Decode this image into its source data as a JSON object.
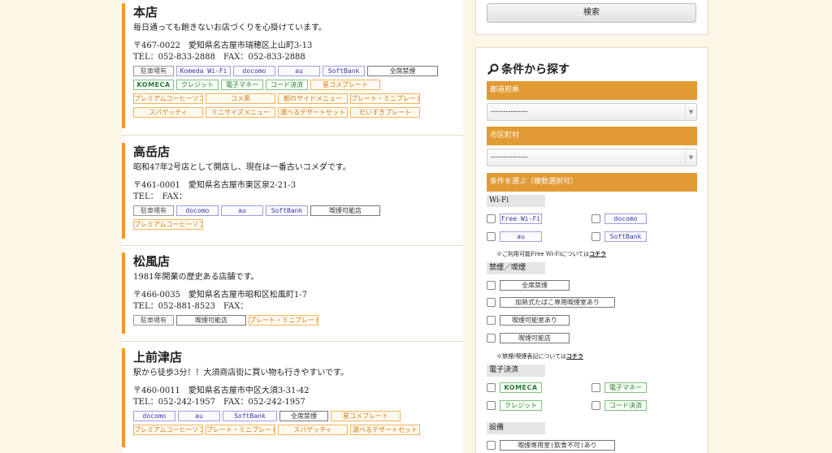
{
  "stores": [
    {
      "name": "本店",
      "description": "毎日通っても飽きないお店づくりを心掛けています。",
      "address": "〒467-0022　愛知県名古屋市瑞穂区上山町3-13",
      "tel": "TEL：052-833-2888　FAX：052-833-2888",
      "tag_rows": [
        [
          {
            "label": "駐車場有",
            "style": "gray",
            "w": 50
          },
          {
            "label": "Komeda Wi-Fi",
            "style": "blue",
            "w": 67
          },
          {
            "label": "docomo",
            "style": "blue",
            "w": 52
          },
          {
            "label": "au",
            "style": "blue",
            "w": 52
          },
          {
            "label": "SoftBank",
            "style": "blue",
            "w": 52
          },
          {
            "label": "全席禁煙",
            "style": "dark",
            "w": 87
          }
        ],
        [
          {
            "label": "KOMECA",
            "style": "green",
            "w": 50,
            "logo": true
          },
          {
            "label": "クレジット",
            "style": "green",
            "w": 52
          },
          {
            "label": "電子マネー",
            "style": "green",
            "w": 52
          },
          {
            "label": "コード決済",
            "style": "green",
            "w": 52
          },
          {
            "label": "星コメプレート",
            "style": "orange",
            "w": 86
          }
        ],
        [
          {
            "label": "プレミアムコーヒーソフィア",
            "style": "orange",
            "w": 86
          },
          {
            "label": "コメ黒",
            "style": "orange",
            "w": 86
          },
          {
            "label": "朝のサイドメニュー",
            "style": "orange",
            "w": 86
          },
          {
            "label": "プレート・ミニプレート",
            "style": "orange",
            "w": 86
          }
        ],
        [
          {
            "label": "スパゲッティ",
            "style": "orange",
            "w": 86
          },
          {
            "label": "ミニサイズメニュー",
            "style": "orange",
            "w": 86
          },
          {
            "label": "選べるデザートセット",
            "style": "orange",
            "w": 86
          },
          {
            "label": "だいすきプレート",
            "style": "orange",
            "w": 86
          }
        ]
      ]
    },
    {
      "name": "高岳店",
      "description": "昭和47年2号店として開店し、現在は一番古いコメダです。",
      "address": "〒461-0001　愛知県名古屋市東区泉2-21-3",
      "tel": "TEL：　FAX：",
      "tag_rows": [
        [
          {
            "label": "駐車場有",
            "style": "gray",
            "w": 50
          },
          {
            "label": "docomo",
            "style": "blue",
            "w": 52
          },
          {
            "label": "au",
            "style": "blue",
            "w": 52
          },
          {
            "label": "SoftBank",
            "style": "blue",
            "w": 52
          },
          {
            "label": "喫煙可能店",
            "style": "dark",
            "w": 86
          }
        ],
        [
          {
            "label": "プレミアムコーヒーソフィア",
            "style": "orange",
            "w": 86
          }
        ]
      ]
    },
    {
      "name": "松風店",
      "description": "1981年開業の歴史ある店舗です。",
      "address": "〒466-0035　愛知県名古屋市昭和区松風町1-7",
      "tel": "TEL：052-881-8523　FAX：",
      "tag_rows": [
        [
          {
            "label": "駐車場有",
            "style": "gray",
            "w": 50
          },
          {
            "label": "喫煙可能店",
            "style": "dark",
            "w": 86
          },
          {
            "label": "プレート・ミニプレート",
            "style": "orange",
            "w": 86
          }
        ]
      ]
    },
    {
      "name": "上前津店",
      "description": "駅から徒歩3分！！大須商店街に買い物も行きやすいです。",
      "address": "〒460-0011　愛知県名古屋市中区大須3-31-42",
      "tel": "TEL：052-242-1957　FAX：052-242-1957",
      "tag_rows": [
        [
          {
            "label": "docomo",
            "style": "blue",
            "w": 52
          },
          {
            "label": "au",
            "style": "blue",
            "w": 52
          },
          {
            "label": "SoftBank",
            "style": "blue",
            "w": 67
          },
          {
            "label": "全席禁煙",
            "style": "dark",
            "w": 60
          },
          {
            "label": "星コメプレート",
            "style": "orange",
            "w": 86
          }
        ],
        [
          {
            "label": "プレミアムコーヒーソフィア",
            "style": "orange",
            "w": 86
          },
          {
            "label": "プレート・ミニプレート",
            "style": "orange",
            "w": 86
          },
          {
            "label": "スパゲッティ",
            "style": "orange",
            "w": 86
          },
          {
            "label": "選べるデザートセット",
            "style": "orange",
            "w": 86
          }
        ]
      ]
    }
  ],
  "search": {
    "button_label": "検索",
    "conditions_title": "条件から探す",
    "prefecture_header": "都道府県",
    "prefecture_value": "---------------",
    "city_header": "市区町村",
    "city_value": "---------------",
    "conditions_header": "条件を選ぶ（複数選択可）",
    "wifi_label": "Wi-Fi",
    "wifi_options": [
      "Free Wi-Fi",
      "docomo",
      "au",
      "SoftBank"
    ],
    "wifi_note_prefix": "※ご利用可能Free Wi-Fiについては",
    "wifi_note_link": "コチラ",
    "smoking_label": "禁煙／喫煙",
    "smoking_options": [
      "全席禁煙",
      "加熱式たばこ専用喫煙室あり",
      "喫煙可能室あり",
      "喫煙可能店"
    ],
    "smoking_note_prefix": "※禁煙/喫煙表記については",
    "smoking_note_link": "コチラ",
    "payment_label": "電子決済",
    "payment_options": [
      "KOMECA",
      "電子マネー",
      "クレジット",
      "コード決済"
    ],
    "equipment_label": "設備",
    "equipment_options": [
      "喫煙専用室(飲食不可)あり"
    ]
  }
}
